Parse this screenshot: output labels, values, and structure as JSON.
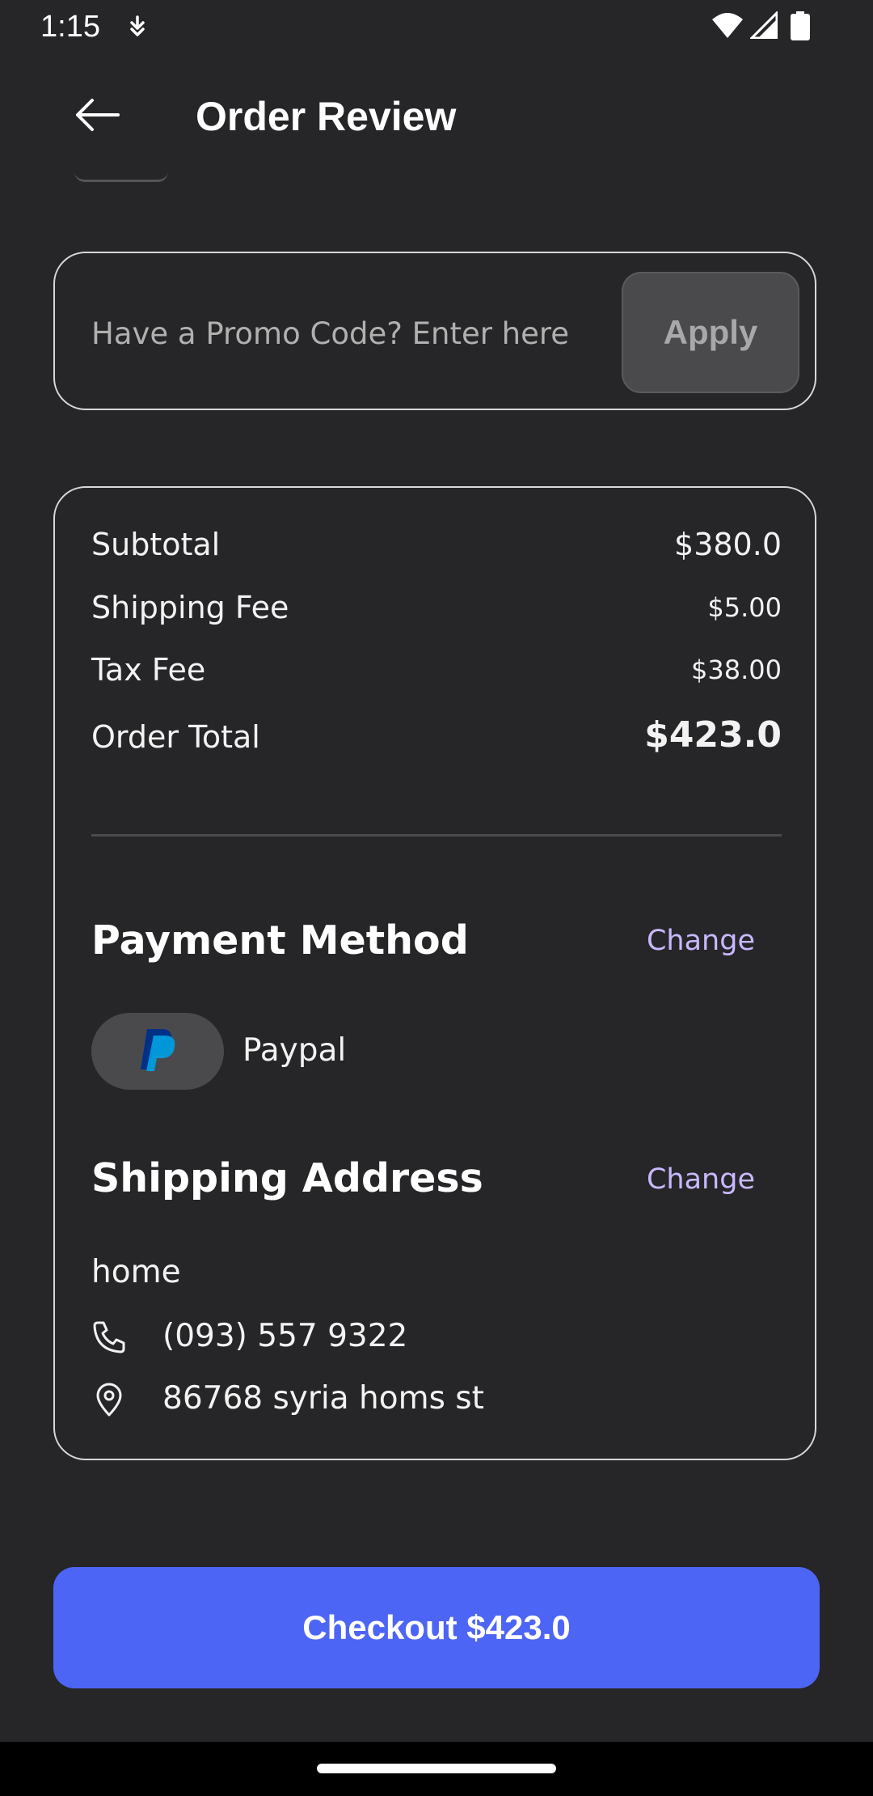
{
  "status_bar": {
    "time": "1:15",
    "icons": [
      "data-saver-icon",
      "wifi-icon",
      "signal-icon",
      "battery-icon"
    ]
  },
  "header": {
    "title": "Order Review",
    "back_icon": "arrow-left-icon"
  },
  "promo": {
    "placeholder": "Have a Promo Code? Enter here",
    "apply_label": "Apply"
  },
  "summary": {
    "subtotal_label": "Subtotal",
    "subtotal_value": "$380.0",
    "shipping_label": "Shipping Fee",
    "shipping_value": "$5.00",
    "tax_label": "Tax Fee",
    "tax_value": "$38.00",
    "total_label": "Order Total",
    "total_value": "$423.0"
  },
  "payment": {
    "title": "Payment Method",
    "change_label": "Change",
    "method_name": "Paypal",
    "method_icon": "paypal-logo-icon"
  },
  "shipping": {
    "title": "Shipping Address",
    "change_label": "Change",
    "address_name": "home",
    "phone": "(093) 557 9322",
    "address": "86768 syria homs st"
  },
  "checkout": {
    "label": "Checkout $423.0"
  },
  "colors": {
    "background": "#262628",
    "accent": "#4d65f5",
    "link": "#c9b8ff",
    "card_border": "#d8d8d8"
  }
}
